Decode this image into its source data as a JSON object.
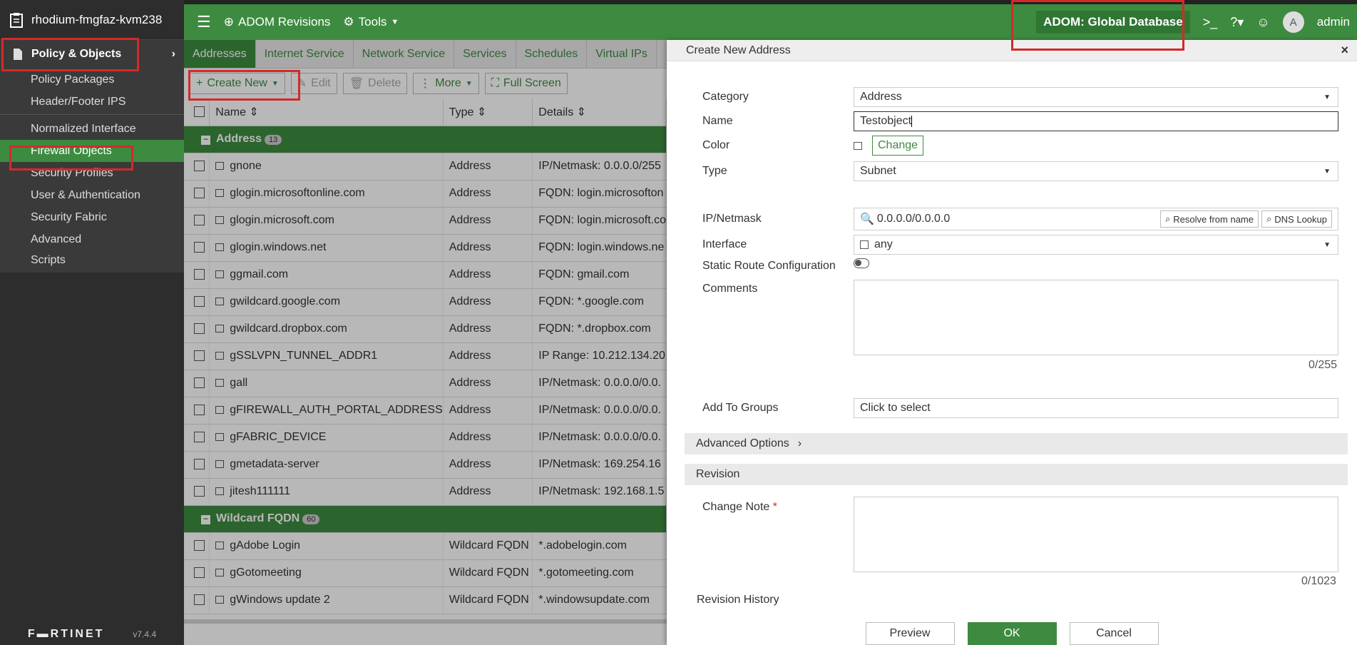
{
  "device_name": "rhodium-fmgfaz-kvm238",
  "sidebar": {
    "section": "Policy & Objects",
    "items": [
      "Policy Packages",
      "Header/Footer IPS",
      "Normalized Interface",
      "Firewall Objects",
      "Security Profiles",
      "User & Authentication",
      "Security Fabric",
      "Advanced",
      "Scripts"
    ],
    "footer_logo": "F▬RTINET",
    "version": "v7.4.4"
  },
  "topbar": {
    "adom_revisions": "ADOM Revisions",
    "tools": "Tools",
    "adom": "ADOM: Global Database",
    "user": "admin",
    "avatar_letter": "A"
  },
  "tabs": [
    "Addresses",
    "Internet Service",
    "Network Service",
    "Services",
    "Schedules",
    "Virtual IPs"
  ],
  "toolbar": {
    "create_new": "Create New",
    "edit": "Edit",
    "delete": "Delete",
    "more": "More",
    "full_screen": "Full Screen"
  },
  "columns": {
    "name": "Name",
    "type": "Type",
    "details": "Details"
  },
  "groups": {
    "address": {
      "label": "Address",
      "count": "13"
    },
    "wildcard": {
      "label": "Wildcard FQDN",
      "count": "60"
    }
  },
  "address_rows": [
    {
      "name": "gnone",
      "type": "Address",
      "details": "IP/Netmask: 0.0.0.0/255"
    },
    {
      "name": "glogin.microsoftonline.com",
      "type": "Address",
      "details": "FQDN: login.microsofton"
    },
    {
      "name": "glogin.microsoft.com",
      "type": "Address",
      "details": "FQDN: login.microsoft.co"
    },
    {
      "name": "glogin.windows.net",
      "type": "Address",
      "details": "FQDN: login.windows.ne"
    },
    {
      "name": "ggmail.com",
      "type": "Address",
      "details": "FQDN: gmail.com"
    },
    {
      "name": "gwildcard.google.com",
      "type": "Address",
      "details": "FQDN: *.google.com"
    },
    {
      "name": "gwildcard.dropbox.com",
      "type": "Address",
      "details": "FQDN: *.dropbox.com"
    },
    {
      "name": "gSSLVPN_TUNNEL_ADDR1",
      "type": "Address",
      "details": "IP Range: 10.212.134.20"
    },
    {
      "name": "gall",
      "type": "Address",
      "details": "IP/Netmask: 0.0.0.0/0.0."
    },
    {
      "name": "gFIREWALL_AUTH_PORTAL_ADDRESS",
      "type": "Address",
      "details": "IP/Netmask: 0.0.0.0/0.0."
    },
    {
      "name": "gFABRIC_DEVICE",
      "type": "Address",
      "details": "IP/Netmask: 0.0.0.0/0.0."
    },
    {
      "name": "gmetadata-server",
      "type": "Address",
      "details": "IP/Netmask: 169.254.16"
    },
    {
      "name": "jitesh111111",
      "type": "Address",
      "details": "IP/Netmask: 192.168.1.5"
    }
  ],
  "wildcard_rows": [
    {
      "name": "gAdobe Login",
      "type": "Wildcard FQDN",
      "details": "*.adobelogin.com"
    },
    {
      "name": "gGotomeeting",
      "type": "Wildcard FQDN",
      "details": "*.gotomeeting.com"
    },
    {
      "name": "gWindows update 2",
      "type": "Wildcard FQDN",
      "details": "*.windowsupdate.com"
    }
  ],
  "panel": {
    "title": "Create New Address",
    "labels": {
      "category": "Category",
      "name": "Name",
      "color": "Color",
      "type": "Type",
      "ipnetmask": "IP/Netmask",
      "interface": "Interface",
      "static_route": "Static Route Configuration",
      "comments": "Comments",
      "add_to_groups": "Add To Groups",
      "change_note": "Change Note",
      "revision_history": "Revision History"
    },
    "values": {
      "category": "Address",
      "name": "Testobject",
      "type": "Subnet",
      "ipnetmask": "0.0.0.0/0.0.0.0",
      "interface": "any",
      "add_to_groups": "Click to select",
      "comments_count": "0/255",
      "change_note_count": "0/1023"
    },
    "buttons": {
      "change": "Change",
      "resolve": "Resolve from name",
      "dns": "DNS Lookup",
      "preview": "Preview",
      "ok": "OK",
      "cancel": "Cancel"
    },
    "sections": {
      "advanced": "Advanced Options",
      "revision": "Revision"
    },
    "required_mark": "*"
  },
  "colors": {
    "brand_green": "#3d8b40",
    "sidebar_bg": "#2d2d2d",
    "highlight_red": "#d32a2a"
  }
}
